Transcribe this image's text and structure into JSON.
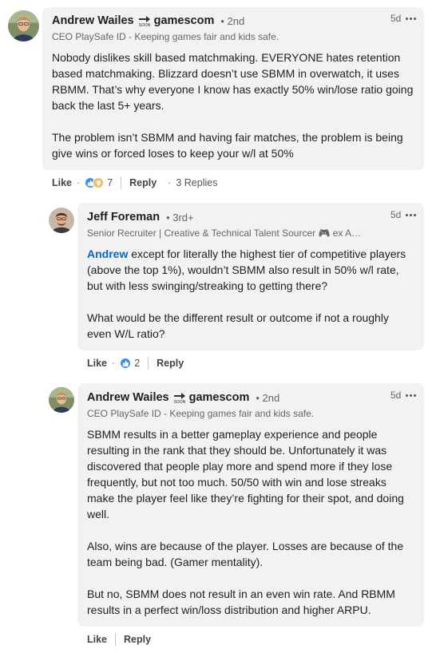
{
  "comments": [
    {
      "author": "Andrew Wailes",
      "badge_icon": "soon-sticker",
      "badge_text": "gamescom",
      "degree": "• 2nd",
      "headline": "CEO PlaySafe ID - Keeping games fair and kids safe.",
      "time": "5d",
      "paragraphs": [
        "Nobody dislikes skill based matchmaking. EVERYONE hates retention based matchmaking. Blizzard doesn’t use SBMM in overwatch, it uses RBMM. That’s why everyone I know has exactly 50% win/lose ratio going back the last 5+ years.",
        "The problem isn’t SBMM and having fair matches, the problem is being give wins or forced loses to keep your w/l at 50%"
      ],
      "like_label": "Like",
      "reaction_count": "7",
      "reply_label": "Reply",
      "replies_label": "3 Replies"
    },
    {
      "author": "Jeff Foreman",
      "degree": "• 3rd+",
      "headline": "Senior Recruiter | Creative & Technical Talent Sourcer 🎮 ex A…",
      "time": "5d",
      "mention": "Andrew",
      "first_paragraph_rest": " except for literally the highest tier of competitive players (above the top 1%), wouldn’t SBMM also result in 50% w/l rate, but with less swinging/streaking to getting there?",
      "second_paragraph": "What would be the different result or outcome if not a roughly even W/L ratio?",
      "like_label": "Like",
      "reaction_count": "2",
      "reply_label": "Reply"
    },
    {
      "author": "Andrew Wailes",
      "badge_icon": "soon-sticker",
      "badge_text": "gamescom",
      "degree": "• 2nd",
      "headline": "CEO PlaySafe ID - Keeping games fair and kids safe.",
      "time": "5d",
      "paragraphs": [
        "SBMM results in a better gameplay experience and people resulting in the rank that they should be. Unfortunately it was discovered that people play more and spend more if they lose frequently, but not too much. 50/50 with win and lose streaks make the player feel like they’re fighting for their spot, and doing well.",
        "Also, wins are because of the player. Losses are because of the team being bad. (Gamer mentality).",
        "But no, SBMM does not result in an even win rate. And RBMM results in a perfect win/loss distribution and higher ARPU."
      ],
      "like_label": "Like",
      "reply_label": "Reply"
    }
  ],
  "colors": {
    "bubble": "#f2f2f2",
    "mention": "#0a66c2",
    "like_reaction": "#378fe9",
    "insight_reaction": "#f5bb5c"
  }
}
